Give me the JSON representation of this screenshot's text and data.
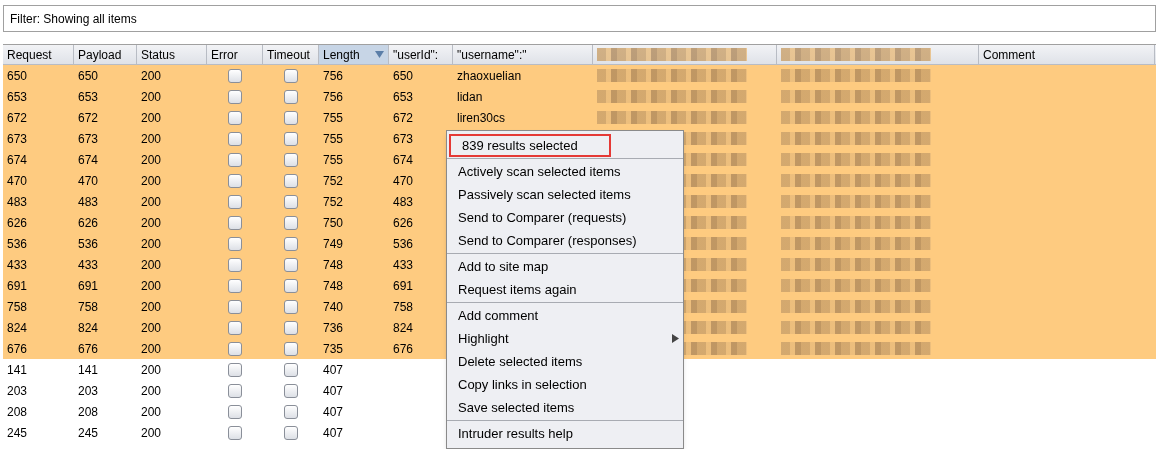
{
  "filter": {
    "text": "Filter: Showing all items"
  },
  "table": {
    "columns": [
      {
        "label": "Request",
        "sorted": false
      },
      {
        "label": "Payload",
        "sorted": false
      },
      {
        "label": "Status",
        "sorted": false
      },
      {
        "label": "Error",
        "sorted": false
      },
      {
        "label": "Timeout",
        "sorted": false
      },
      {
        "label": "Length",
        "sorted": true
      },
      {
        "label": "\"userId\":",
        "sorted": false
      },
      {
        "label": "\"username\":\"",
        "sorted": false
      },
      {
        "sorted": false,
        "redacted": true
      },
      {
        "sorted": false,
        "redacted": true
      },
      {
        "label": "Comment",
        "sorted": false
      }
    ],
    "rows": [
      {
        "selected": true,
        "request": "650",
        "payload": "650",
        "status": "200",
        "error": false,
        "timeout": false,
        "length": "756",
        "user_id": "650",
        "username": "zhaoxuelian",
        "redacted": true
      },
      {
        "selected": true,
        "request": "653",
        "payload": "653",
        "status": "200",
        "error": false,
        "timeout": false,
        "length": "756",
        "user_id": "653",
        "username": "lidan",
        "redacted": true
      },
      {
        "selected": true,
        "request": "672",
        "payload": "672",
        "status": "200",
        "error": false,
        "timeout": false,
        "length": "755",
        "user_id": "672",
        "username": "liren30cs",
        "redacted": true
      },
      {
        "selected": true,
        "request": "673",
        "payload": "673",
        "status": "200",
        "error": false,
        "timeout": false,
        "length": "755",
        "user_id": "673",
        "redacted": true
      },
      {
        "selected": true,
        "request": "674",
        "payload": "674",
        "status": "200",
        "error": false,
        "timeout": false,
        "length": "755",
        "user_id": "674",
        "redacted": true
      },
      {
        "selected": true,
        "request": "470",
        "payload": "470",
        "status": "200",
        "error": false,
        "timeout": false,
        "length": "752",
        "user_id": "470",
        "redacted": true
      },
      {
        "selected": true,
        "request": "483",
        "payload": "483",
        "status": "200",
        "error": false,
        "timeout": false,
        "length": "752",
        "user_id": "483",
        "redacted": true
      },
      {
        "selected": true,
        "request": "626",
        "payload": "626",
        "status": "200",
        "error": false,
        "timeout": false,
        "length": "750",
        "user_id": "626",
        "redacted": true
      },
      {
        "selected": true,
        "request": "536",
        "payload": "536",
        "status": "200",
        "error": false,
        "timeout": false,
        "length": "749",
        "user_id": "536",
        "redacted": true
      },
      {
        "selected": true,
        "request": "433",
        "payload": "433",
        "status": "200",
        "error": false,
        "timeout": false,
        "length": "748",
        "user_id": "433",
        "redacted": true
      },
      {
        "selected": true,
        "request": "691",
        "payload": "691",
        "status": "200",
        "error": false,
        "timeout": false,
        "length": "748",
        "user_id": "691",
        "redacted": true
      },
      {
        "selected": true,
        "request": "758",
        "payload": "758",
        "status": "200",
        "error": false,
        "timeout": false,
        "length": "740",
        "user_id": "758",
        "redacted": true
      },
      {
        "selected": true,
        "request": "824",
        "payload": "824",
        "status": "200",
        "error": false,
        "timeout": false,
        "length": "736",
        "user_id": "824",
        "redacted": true
      },
      {
        "selected": true,
        "request": "676",
        "payload": "676",
        "status": "200",
        "error": false,
        "timeout": false,
        "length": "735",
        "user_id": "676",
        "redacted": true
      },
      {
        "selected": false,
        "request": "141",
        "payload": "141",
        "status": "200",
        "error": false,
        "timeout": false,
        "length": "407",
        "redacted": false
      },
      {
        "selected": false,
        "request": "203",
        "payload": "203",
        "status": "200",
        "error": false,
        "timeout": false,
        "length": "407",
        "redacted": false
      },
      {
        "selected": false,
        "request": "208",
        "payload": "208",
        "status": "200",
        "error": false,
        "timeout": false,
        "length": "407",
        "redacted": false
      },
      {
        "selected": false,
        "request": "245",
        "payload": "245",
        "status": "200",
        "error": false,
        "timeout": false,
        "length": "407",
        "redacted": false
      }
    ]
  },
  "context_menu": {
    "groups": [
      [
        {
          "label": "839 results selected",
          "outlined": true,
          "submenu": false
        }
      ],
      [
        {
          "label": "Actively scan selected items",
          "outlined": false,
          "submenu": false
        },
        {
          "label": "Passively scan selected items",
          "outlined": false,
          "submenu": false
        },
        {
          "label": "Send to Comparer (requests)",
          "outlined": false,
          "submenu": false
        },
        {
          "label": "Send to Comparer (responses)",
          "outlined": false,
          "submenu": false
        }
      ],
      [
        {
          "label": "Add to site map",
          "outlined": false,
          "submenu": false
        },
        {
          "label": "Request items again",
          "outlined": false,
          "submenu": false
        }
      ],
      [
        {
          "label": "Add comment",
          "outlined": false,
          "submenu": false
        },
        {
          "label": "Highlight",
          "outlined": false,
          "submenu": true
        },
        {
          "label": "Delete selected items",
          "outlined": false,
          "submenu": false
        },
        {
          "label": "Copy links in selection",
          "outlined": false,
          "submenu": false
        },
        {
          "label": "Save selected items",
          "outlined": false,
          "submenu": false
        }
      ],
      [
        {
          "label": "Intruder results help",
          "outlined": false,
          "submenu": false
        }
      ]
    ]
  }
}
